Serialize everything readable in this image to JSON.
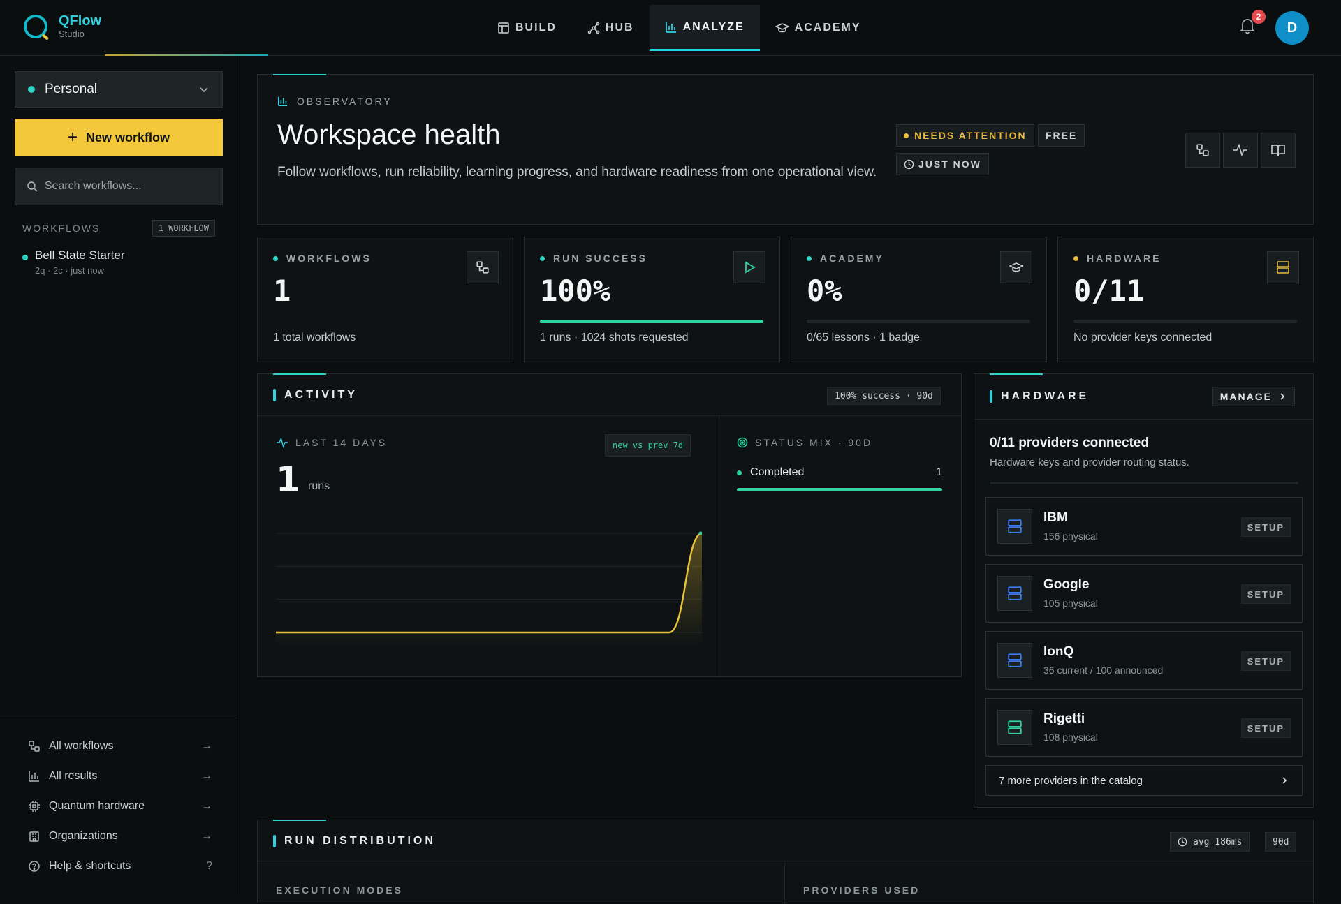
{
  "app": {
    "name": "QFlow",
    "subtitle": "Studio"
  },
  "nav": {
    "tabs": [
      {
        "label": "BUILD",
        "icon": "layout-icon",
        "active": false
      },
      {
        "label": "HUB",
        "icon": "hub-icon",
        "active": false
      },
      {
        "label": "ANALYZE",
        "icon": "bar-chart-icon",
        "active": true
      },
      {
        "label": "ACADEMY",
        "icon": "graduation-cap-icon",
        "active": false
      }
    ],
    "notifications": "2",
    "avatar": "D"
  },
  "sidebar": {
    "workspace": "Personal",
    "new_workflow": "New workflow",
    "search_placeholder": "Search workflows...",
    "workflows_label": "WORKFLOWS",
    "workflows_count": "1 WORKFLOW",
    "workflows": [
      {
        "name": "Bell State Starter",
        "meta": "2q · 2c · just now"
      }
    ],
    "links": [
      {
        "label": "All workflows",
        "icon": "workflow-icon",
        "trail": "→"
      },
      {
        "label": "All results",
        "icon": "bar-chart-icon",
        "trail": "→"
      },
      {
        "label": "Quantum hardware",
        "icon": "chip-icon",
        "trail": "→"
      },
      {
        "label": "Organizations",
        "icon": "building-icon",
        "trail": "→"
      },
      {
        "label": "Help & shortcuts",
        "icon": "help-icon",
        "trail": "?"
      }
    ]
  },
  "hero": {
    "eyebrow": "OBSERVATORY",
    "title": "Workspace health",
    "description": "Follow workflows, run reliability, learning progress, and hardware readiness from one operational view.",
    "status_chip": "NEEDS ATTENTION",
    "plan_chip": "FREE",
    "time_chip": "JUST NOW"
  },
  "stats": [
    {
      "label": "WORKFLOWS",
      "value": "1",
      "foot": "1 total workflows",
      "progress": null,
      "dot": "teal",
      "icon": "workflow-icon"
    },
    {
      "label": "RUN SUCCESS",
      "value": "100%",
      "foot": "1 runs · 1024 shots requested",
      "progress": 1.0,
      "dot": "teal",
      "icon": "play-icon"
    },
    {
      "label": "ACADEMY",
      "value": "0%",
      "foot": "0/65 lessons · 1 badge",
      "progress": 0.0,
      "dot": "teal",
      "icon": "graduation-cap-icon"
    },
    {
      "label": "HARDWARE",
      "value": "0/11",
      "foot": "No provider keys connected",
      "progress": 0.0,
      "dot": "yellow",
      "icon": "server-icon"
    }
  ],
  "activity": {
    "title": "ACTIVITY",
    "tag": "100% success · 90d",
    "last_label": "LAST 14 DAYS",
    "compare_tag": "new vs prev 7d",
    "runs_value": "1",
    "runs_unit": "runs",
    "status_label": "STATUS MIX · 90D",
    "status_items": [
      {
        "label": "Completed",
        "count": "1",
        "share": 1.0
      }
    ]
  },
  "chart_data": {
    "type": "area",
    "x": [
      1,
      2,
      3,
      4,
      5,
      6,
      7,
      8,
      9,
      10,
      11,
      12,
      13,
      14
    ],
    "values": [
      0,
      0,
      0,
      0,
      0,
      0,
      0,
      0,
      0,
      0,
      0,
      0,
      0,
      1
    ],
    "title": "",
    "xlabel": "",
    "ylabel": "",
    "ylim": [
      0,
      1
    ],
    "grid": true,
    "color": "#e8c338"
  },
  "hardware": {
    "title": "HARDWARE",
    "manage": "MANAGE",
    "summary": "0/11 providers connected",
    "summary_sub": "Hardware keys and provider routing status.",
    "providers": [
      {
        "name": "IBM",
        "detail": "156 physical",
        "action": "SETUP",
        "color": "#3b7bf0"
      },
      {
        "name": "Google",
        "detail": "105 physical",
        "action": "SETUP",
        "color": "#3b7bf0"
      },
      {
        "name": "IonQ",
        "detail": "36 current / 100 announced",
        "action": "SETUP",
        "color": "#3b7bf0"
      },
      {
        "name": "Rigetti",
        "detail": "108 physical",
        "action": "SETUP",
        "color": "#2fd3a0"
      }
    ],
    "more": "7 more providers in the catalog"
  },
  "distribution": {
    "title": "RUN DISTRIBUTION",
    "avg_tag": "avg 186ms",
    "range_tag": "90d",
    "left_label": "EXECUTION MODES",
    "right_label": "PROVIDERS USED"
  }
}
